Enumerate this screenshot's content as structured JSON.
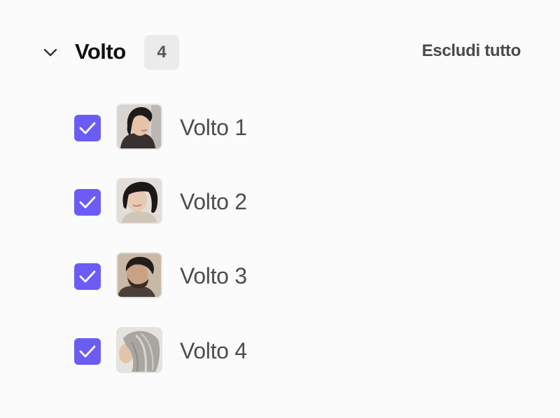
{
  "section": {
    "title": "Volto",
    "count": "4",
    "exclude_all_label": "Escludi tutto",
    "accent_color": "#6b5cf5"
  },
  "faces": [
    {
      "label": "Volto 1",
      "checked": true,
      "thumbnail": "woman-dark-hair-smiling"
    },
    {
      "label": "Volto 2",
      "checked": true,
      "thumbnail": "woman-bangs-bob"
    },
    {
      "label": "Volto 3",
      "checked": true,
      "thumbnail": "man-beard-dark-hair"
    },
    {
      "label": "Volto 4",
      "checked": true,
      "thumbnail": "person-gray-hair"
    }
  ]
}
